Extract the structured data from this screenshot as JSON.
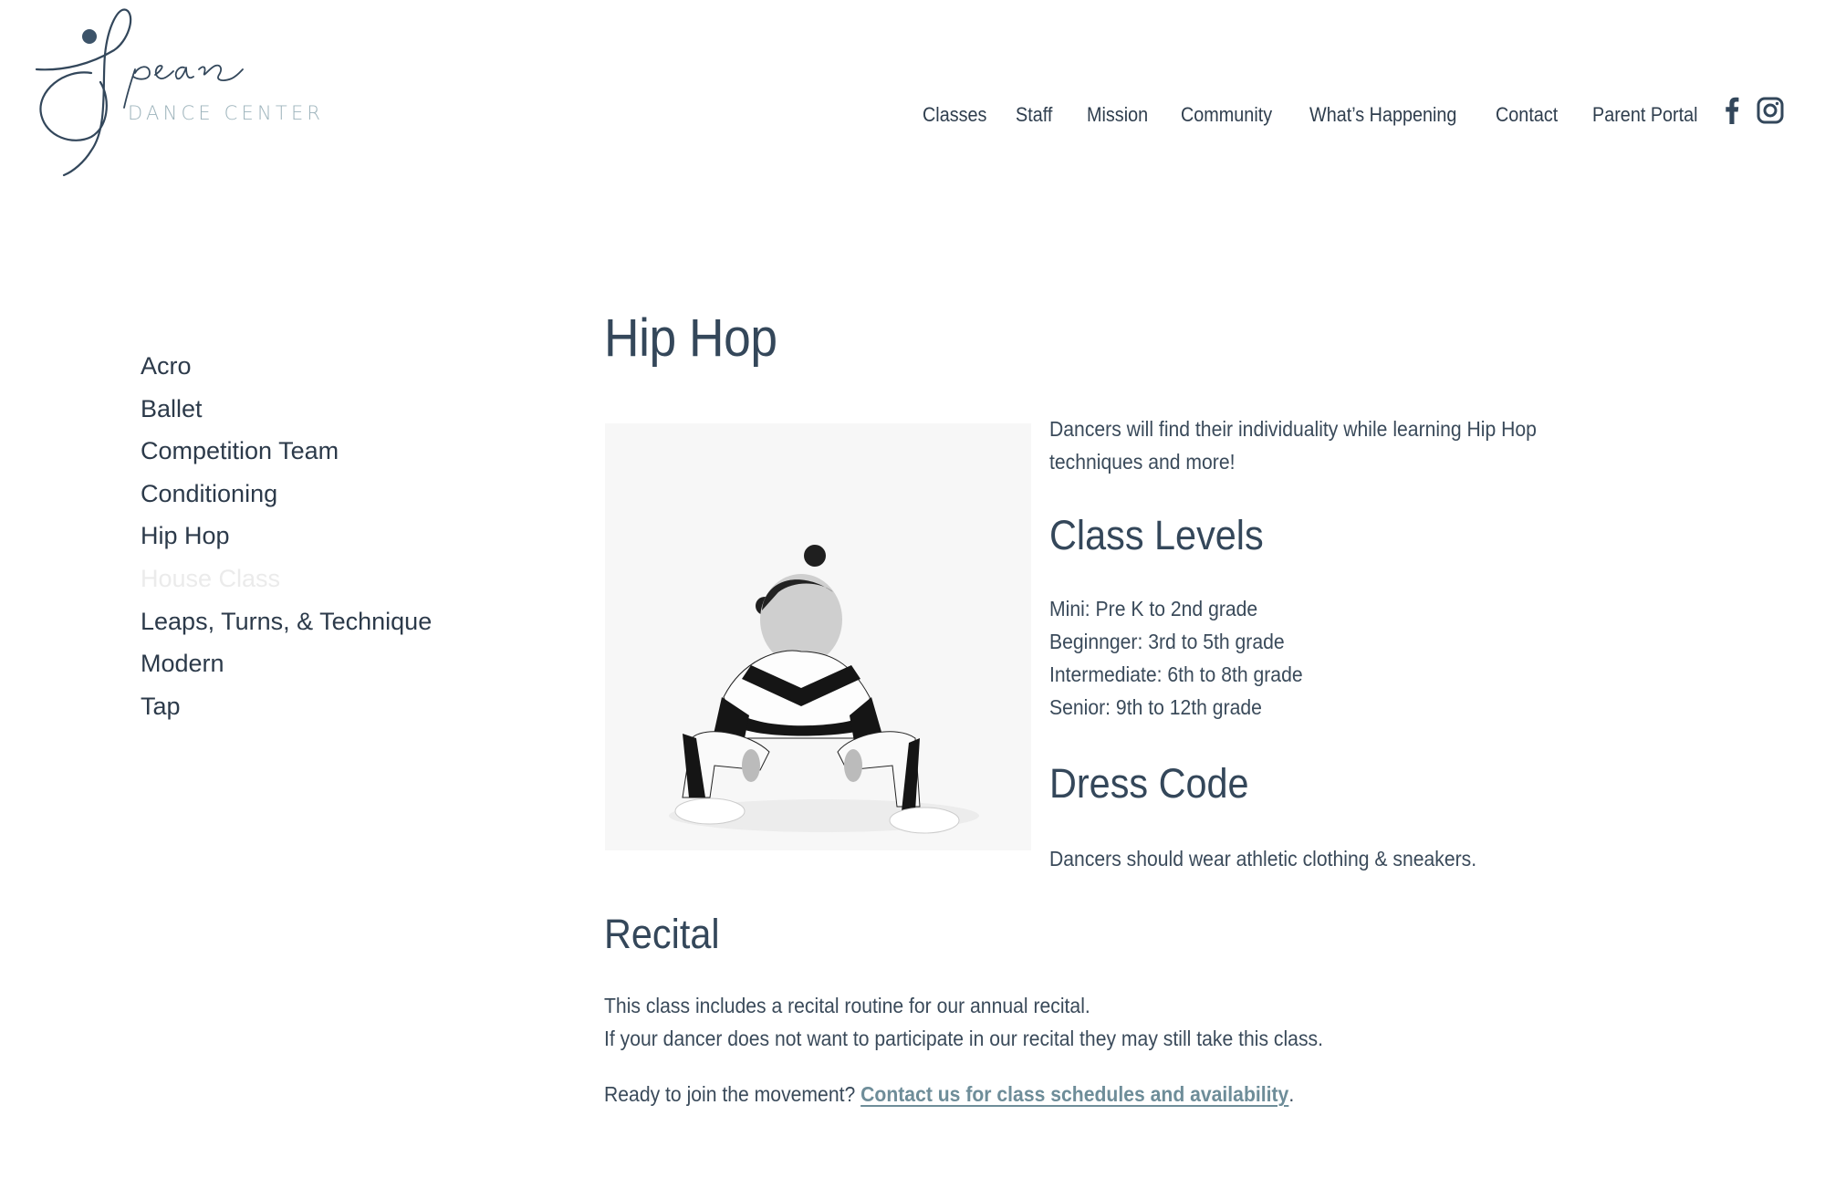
{
  "logo": {
    "script_text": "Spear",
    "subtitle": "DANCE CENTER"
  },
  "nav": {
    "items": [
      {
        "label": "Classes"
      },
      {
        "label": "Staff"
      },
      {
        "label": "Mission"
      },
      {
        "label": "Community"
      },
      {
        "label": "What’s Happening"
      },
      {
        "label": "Contact"
      },
      {
        "label": "Parent Portal"
      }
    ],
    "social": [
      {
        "icon": "facebook-icon",
        "label": "Facebook"
      },
      {
        "icon": "instagram-icon",
        "label": "Instagram"
      }
    ]
  },
  "sidebar": {
    "items": [
      {
        "label": "Acro",
        "state": "normal"
      },
      {
        "label": "Ballet",
        "state": "normal"
      },
      {
        "label": "Competition Team",
        "state": "normal"
      },
      {
        "label": "Conditioning",
        "state": "normal"
      },
      {
        "label": "Hip Hop",
        "state": "normal"
      },
      {
        "label": "House Class",
        "state": "muted"
      },
      {
        "label": "Leaps, Turns, & Technique",
        "state": "normal"
      },
      {
        "label": "Modern",
        "state": "normal"
      },
      {
        "label": "Tap",
        "state": "normal"
      }
    ]
  },
  "main": {
    "title": "Hip Hop",
    "hero_image_alt": "Child in black and white outfit squatting in a hip hop pose",
    "intro_lines": [
      "Dancers will find their individuality while learning Hip Hop",
      "techniques and more!"
    ],
    "class_levels": {
      "title": "Class Levels",
      "items": [
        "Mini: Pre K to 2nd grade",
        "Beginnger: 3rd to 5th grade",
        "Intermediate: 6th to 8th grade",
        "Senior: 9th to 12th grade"
      ]
    },
    "dress_code": {
      "title": "Dress Code",
      "text": "Dancers should wear athletic clothing & sneakers."
    },
    "recital": {
      "title": "Recital",
      "lines": [
        "This class includes a recital routine for our annual recital.",
        "If your dancer does not want to participate in our recital they may still take this class."
      ]
    },
    "cta": {
      "prefix": "Ready to join the movement? ",
      "link_text": "Contact us for class schedules and availability",
      "suffix": "."
    }
  },
  "colors": {
    "text": "#2f3e4e",
    "heading": "#34475a",
    "logo_subtitle": "#9eb4bc",
    "link": "#6e8d99",
    "muted_item": "#ebebeb",
    "image_bg": "#f6f6f6"
  }
}
